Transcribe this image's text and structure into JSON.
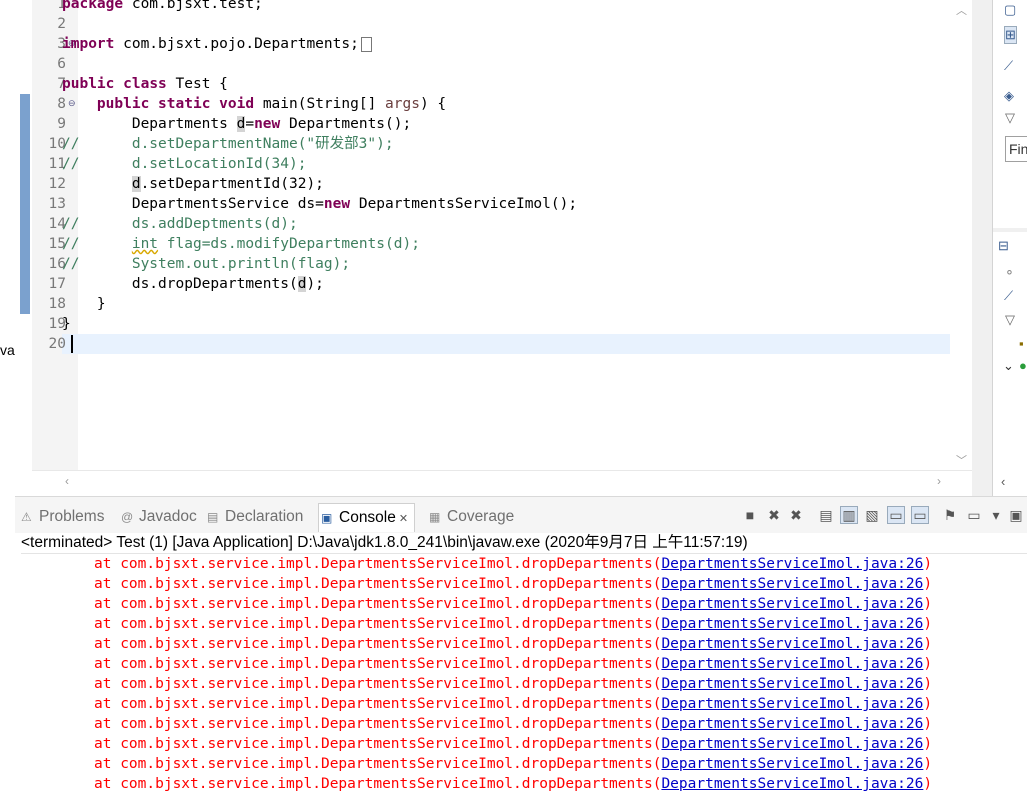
{
  "left_strip": {
    "cut_text": "va"
  },
  "editor": {
    "lines": [
      {
        "num": "1",
        "segments": [
          {
            "t": "package",
            "c": "kw"
          },
          {
            "t": " com.bjsxt.test;",
            "c": ""
          }
        ]
      },
      {
        "num": "2",
        "segments": []
      },
      {
        "num": "3",
        "segments": [
          {
            "t": "import",
            "c": "kw"
          },
          {
            "t": " com.bjsxt.pojo.Departments;",
            "c": ""
          }
        ]
      },
      {
        "num": "6",
        "segments": []
      },
      {
        "num": "7",
        "segments": [
          {
            "t": "public",
            "c": "kw"
          },
          {
            "t": " ",
            "c": ""
          },
          {
            "t": "class",
            "c": "kw"
          },
          {
            "t": " Test {",
            "c": ""
          }
        ]
      },
      {
        "num": "8",
        "segments": [
          {
            "t": "    ",
            "c": ""
          },
          {
            "t": "public",
            "c": "kw"
          },
          {
            "t": " ",
            "c": ""
          },
          {
            "t": "static",
            "c": "kw"
          },
          {
            "t": " ",
            "c": ""
          },
          {
            "t": "void",
            "c": "kw"
          },
          {
            "t": " main(String[] ",
            "c": ""
          },
          {
            "t": "args",
            "c": "var"
          },
          {
            "t": ") {",
            "c": ""
          }
        ]
      },
      {
        "num": "9",
        "segments": [
          {
            "t": "        Departments ",
            "c": ""
          },
          {
            "t": "d",
            "c": "occ"
          },
          {
            "t": "=",
            "c": ""
          },
          {
            "t": "new",
            "c": "kw"
          },
          {
            "t": " Departments();",
            "c": ""
          }
        ]
      },
      {
        "num": "10",
        "segments": [
          {
            "t": "//      d.setDepartmentName(\"",
            "c": "cm"
          },
          {
            "t": "研发部",
            "c": "cm-str"
          },
          {
            "t": "3\");",
            "c": "cm"
          }
        ]
      },
      {
        "num": "11",
        "segments": [
          {
            "t": "//      d.setLocationId(34);",
            "c": "cm"
          }
        ]
      },
      {
        "num": "12",
        "segments": [
          {
            "t": "        ",
            "c": ""
          },
          {
            "t": "d",
            "c": "occ"
          },
          {
            "t": ".setDepartmentId(32);",
            "c": ""
          }
        ]
      },
      {
        "num": "13",
        "segments": [
          {
            "t": "        DepartmentsService ds=",
            "c": ""
          },
          {
            "t": "new",
            "c": "kw"
          },
          {
            "t": " DepartmentsServiceImol();",
            "c": ""
          }
        ]
      },
      {
        "num": "14",
        "segments": [
          {
            "t": "//      ds.addDeptments(d);",
            "c": "cm"
          }
        ]
      },
      {
        "num": "15",
        "segments": [
          {
            "t": "//      ",
            "c": "cm"
          },
          {
            "t": "int",
            "c": "cm squig"
          },
          {
            "t": " flag=ds.modifyDepartments(d);",
            "c": "cm"
          }
        ]
      },
      {
        "num": "16",
        "segments": [
          {
            "t": "//      System.out.println(flag);",
            "c": "cm"
          }
        ]
      },
      {
        "num": "17",
        "segments": [
          {
            "t": "        ds.dropDepartments(",
            "c": ""
          },
          {
            "t": "d",
            "c": "occ"
          },
          {
            "t": ");",
            "c": ""
          }
        ]
      },
      {
        "num": "18",
        "segments": [
          {
            "t": "    }",
            "c": ""
          }
        ]
      },
      {
        "num": "19",
        "segments": [
          {
            "t": "}",
            "c": ""
          }
        ]
      },
      {
        "num": "20",
        "segments": []
      }
    ]
  },
  "right_panel": {
    "find_placeholder": "Fin"
  },
  "console_view": {
    "tabs": [
      {
        "label": "Problems",
        "icon": "problems-icon",
        "glyph": "⚠"
      },
      {
        "label": "Javadoc",
        "icon": "javadoc-icon",
        "glyph": "@"
      },
      {
        "label": "Declaration",
        "icon": "declaration-icon",
        "glyph": "▤"
      },
      {
        "label": "Console",
        "icon": "console-icon",
        "glyph": "▣",
        "active": true,
        "close": "✕"
      },
      {
        "label": "Coverage",
        "icon": "coverage-icon",
        "glyph": "▦"
      }
    ],
    "toolbar": [
      {
        "name": "terminate-icon",
        "glyph": "■"
      },
      {
        "name": "remove-launch-icon",
        "glyph": "✖"
      },
      {
        "name": "remove-all-launches-icon",
        "glyph": "✖"
      },
      {
        "name": "clear-console-icon",
        "glyph": "▤"
      },
      {
        "name": "scroll-lock-icon",
        "glyph": "▥",
        "active": true
      },
      {
        "name": "word-wrap-icon",
        "glyph": "▧"
      },
      {
        "name": "show-on-stdout-icon",
        "glyph": "▭",
        "active": true
      },
      {
        "name": "show-on-stderr-icon",
        "glyph": "▭",
        "active": true
      },
      {
        "name": "pin-console-icon",
        "glyph": "⚑"
      },
      {
        "name": "display-console-icon",
        "glyph": "▭"
      },
      {
        "name": "dropdown-icon",
        "glyph": "▾"
      },
      {
        "name": "new-console-icon",
        "glyph": "▣"
      }
    ],
    "terminated_label": "<terminated> Test (1) [Java Application] D:\\Java\\jdk1.8.0_241\\bin\\javaw.exe (2020年9月7日 上午11:57:19)",
    "trace_prefix": "at com.bjsxt.service.impl.DepartmentsServiceImol.dropDepartments(",
    "trace_link": "DepartmentsServiceImol.java:26",
    "trace_suffix": ")",
    "trace_count": 12
  },
  "colors": {
    "keyword": "#7f0055",
    "comment": "#3f7f5f",
    "error": "#ff0000",
    "link": "#0000c8",
    "current_line": "#e8f2fe"
  }
}
